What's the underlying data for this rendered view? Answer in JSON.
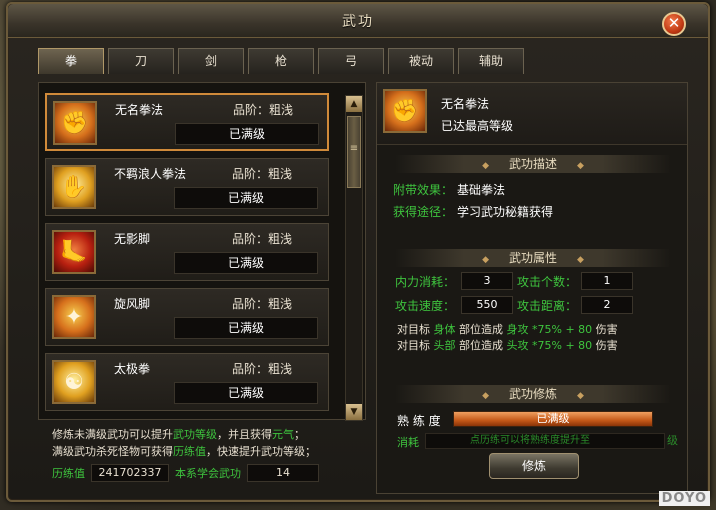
{
  "window": {
    "title": "武功",
    "close_glyph": "✕"
  },
  "tabs": [
    {
      "label": "拳",
      "active": true
    },
    {
      "label": "刀",
      "active": false
    },
    {
      "label": "剑",
      "active": false
    },
    {
      "label": "枪",
      "active": false
    },
    {
      "label": "弓",
      "active": false
    },
    {
      "label": "被动",
      "active": false
    },
    {
      "label": "辅助",
      "active": false
    }
  ],
  "skills": [
    {
      "name": "无名拳法",
      "grade": "品阶：粗浅",
      "status": "已满级",
      "icon": "fist-icon",
      "selected": true
    },
    {
      "name": "不羁浪人拳法",
      "grade": "品阶：粗浅",
      "status": "已满级",
      "icon": "open-hand-icon",
      "selected": false
    },
    {
      "name": "无影脚",
      "grade": "品阶：粗浅",
      "status": "已满级",
      "icon": "kick-icon",
      "selected": false
    },
    {
      "name": "旋风脚",
      "grade": "品阶：粗浅",
      "status": "已满级",
      "icon": "whirlwind-kick-icon",
      "selected": false
    },
    {
      "name": "太极拳",
      "grade": "品阶：粗浅",
      "status": "已满级",
      "icon": "taiji-icon",
      "selected": false
    }
  ],
  "tips": {
    "line1_pre": "修炼未满级武功可以提升",
    "line1_hl1": "武功等级",
    "line1_mid": "，并且获得",
    "line1_hl2": "元气",
    "line1_end": "；",
    "line2_pre": "满级武功杀死怪物可获得",
    "line2_hl": "历练值",
    "line2_end": "，快速提升武功等级；"
  },
  "stats": {
    "exp_label": "历练值",
    "exp_value": "241702337",
    "learned_label": "本系学会武功",
    "learned_value": "14"
  },
  "selected": {
    "name": "无名拳法",
    "level_text": "已达最高等级"
  },
  "description": {
    "header": "武功描述",
    "effect_label": "附带效果：",
    "effect_value": "基础拳法",
    "source_label": "获得途径：",
    "source_value": "学习武功秘籍获得"
  },
  "attributes": {
    "header": "武功属性",
    "mp_cost_label": "内力消耗：",
    "mp_cost": "3",
    "targets_label": "攻击个数：",
    "targets": "1",
    "speed_label": "攻击速度：",
    "speed": "550",
    "range_label": "攻击距离：",
    "range": "2",
    "dmg1": {
      "pre": "对目标",
      "part": "身体",
      "mid": "部位造成",
      "atk": "身攻",
      "pct": "*75%",
      "plus": "+ 80",
      "post": "伤害"
    },
    "dmg2": {
      "pre": "对目标",
      "part": "头部",
      "mid": "部位造成",
      "atk": "头攻",
      "pct": "*75%",
      "plus": "+ 80",
      "post": "伤害"
    }
  },
  "training": {
    "header": "武功修炼",
    "prof_label": "熟 练 度",
    "prof_value": "已满级",
    "consume_label": "消耗",
    "consume_text": "点历练可以将熟练度提升至",
    "consume_suffix": "级",
    "train_button": "修炼"
  },
  "watermark": "DOYO"
}
